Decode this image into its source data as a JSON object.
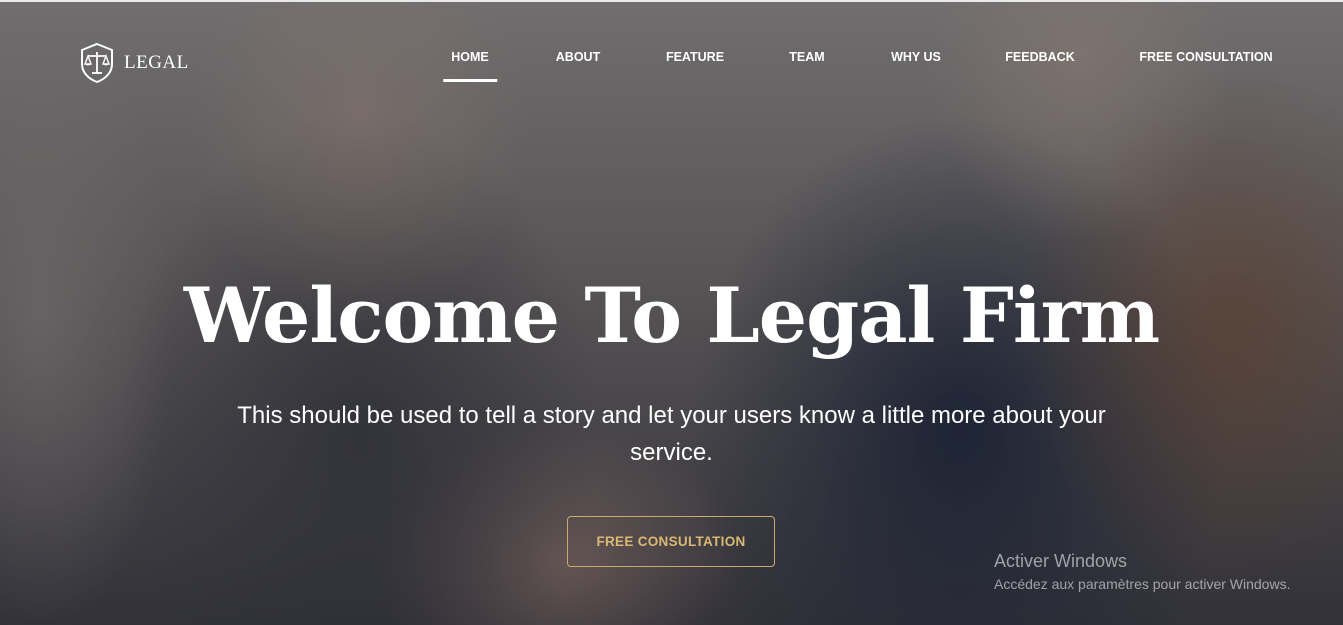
{
  "logo": {
    "text": "LEGAL",
    "icon": "scales-shield-icon"
  },
  "nav": {
    "items": [
      {
        "label": "HOME",
        "active": true
      },
      {
        "label": "ABOUT",
        "active": false
      },
      {
        "label": "FEATURE",
        "active": false
      },
      {
        "label": "TEAM",
        "active": false
      },
      {
        "label": "WHY US",
        "active": false
      },
      {
        "label": "FEEDBACK",
        "active": false
      },
      {
        "label": "FREE CONSULTATION",
        "active": false
      }
    ]
  },
  "hero": {
    "title": "Welcome To Legal Firm",
    "subtitle": "This should be used to tell a story and let your users know a little more about your service.",
    "cta_label": "FREE CONSULTATION"
  },
  "watermark": {
    "title": "Activer Windows",
    "subtitle": "Accédez aux paramètres pour activer Windows."
  },
  "colors": {
    "accent": "#d9b874",
    "text": "#ffffff"
  }
}
